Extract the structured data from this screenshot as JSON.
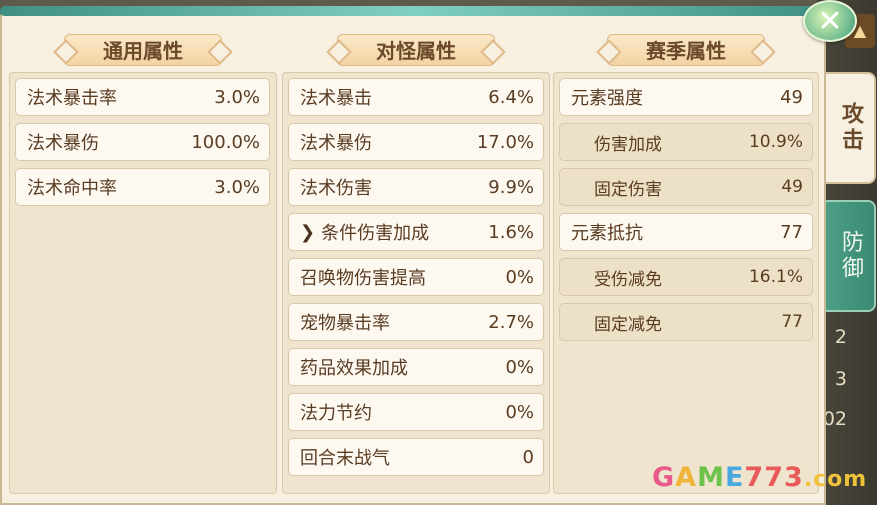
{
  "columns": [
    {
      "title": "通用属性",
      "rows": [
        {
          "label": "法术暴击率",
          "value": "3.0%"
        },
        {
          "label": "法术暴伤",
          "value": "100.0%"
        },
        {
          "label": "法术命中率",
          "value": "3.0%"
        }
      ]
    },
    {
      "title": "对怪属性",
      "rows": [
        {
          "label": "法术暴击",
          "value": "6.4%"
        },
        {
          "label": "法术暴伤",
          "value": "17.0%"
        },
        {
          "label": "法术伤害",
          "value": "9.9%"
        },
        {
          "label": "条件伤害加成",
          "value": "1.6%"
        },
        {
          "label": "召唤物伤害提高",
          "value": "0%"
        },
        {
          "label": "宠物暴击率",
          "value": "2.7%"
        },
        {
          "label": "药品效果加成",
          "value": "0%"
        },
        {
          "label": "法力节约",
          "value": "0%"
        },
        {
          "label": "回合末战气",
          "value": "0"
        }
      ]
    },
    {
      "title": "赛季属性",
      "rows": [
        {
          "label": "元素强度",
          "value": "49"
        },
        {
          "label": "伤害加成",
          "value": "10.9%"
        },
        {
          "label": "固定伤害",
          "value": "49"
        },
        {
          "label": "元素抵抗",
          "value": "77"
        },
        {
          "label": "受伤减免",
          "value": "16.1%"
        },
        {
          "label": "固定减免",
          "value": "77"
        }
      ]
    }
  ],
  "tabs": [
    {
      "label": "攻击",
      "active": true
    },
    {
      "label": "防御",
      "active": false
    }
  ],
  "background_numbers": [
    "2",
    "3",
    "02"
  ],
  "watermark": {
    "g": "G",
    "a": "A",
    "m": "M",
    "e": "E",
    "n": "773",
    "dot": ".com"
  },
  "colors": {
    "panel_bg": "#f7efe0",
    "accent_teal": "#55a79a",
    "text_brown": "#5a3c22"
  }
}
